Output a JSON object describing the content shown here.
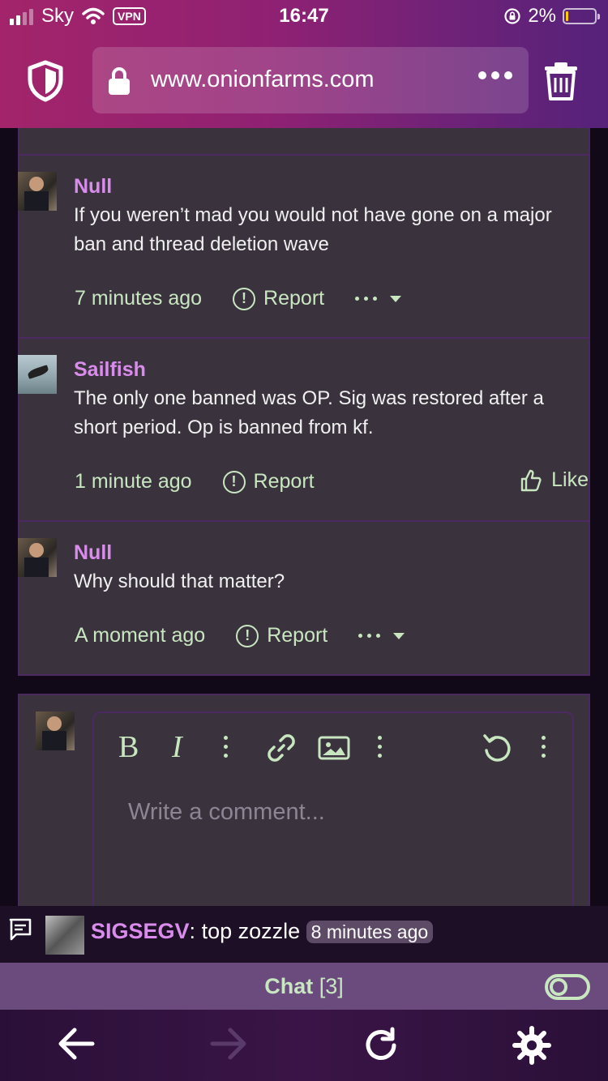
{
  "status_bar": {
    "carrier": "Sky",
    "vpn": "VPN",
    "time": "16:47",
    "battery": "2%",
    "icons": [
      "signal-icon",
      "wifi-icon",
      "rotation-lock-icon",
      "battery-icon"
    ]
  },
  "browser": {
    "url": "www.onionfarms.com",
    "icons": [
      "shield-icon",
      "lock-icon",
      "more-icon",
      "trash-icon"
    ]
  },
  "comments": [
    {
      "user": "Null",
      "text": "If you weren’t mad you would not have gone on a major ban and thread deletion wave",
      "time": "7 minutes ago",
      "report": "Report"
    },
    {
      "user": "Sailfish",
      "text": "The only one banned was OP. Sig was restored after a short period. Op is banned from kf.",
      "time": "1 minute ago",
      "report": "Report",
      "like": "Like"
    },
    {
      "user": "Null",
      "text": "Why should that matter?",
      "time": "A moment ago",
      "report": "Report"
    }
  ],
  "editor": {
    "bold": "B",
    "italic": "I",
    "placeholder": "Write a comment..."
  },
  "chat": {
    "last_user": "SIGSEGV",
    "separator": ":",
    "last_message": "top zozzle",
    "last_time": "8 minutes ago",
    "bar_label": "Chat",
    "bar_count": "[3]"
  },
  "colors": {
    "chrome_start": "#a3246a",
    "chrome_end": "#55227a",
    "username": "#d98cec",
    "meta": "#c8e6c0",
    "card": "#3a333e"
  }
}
